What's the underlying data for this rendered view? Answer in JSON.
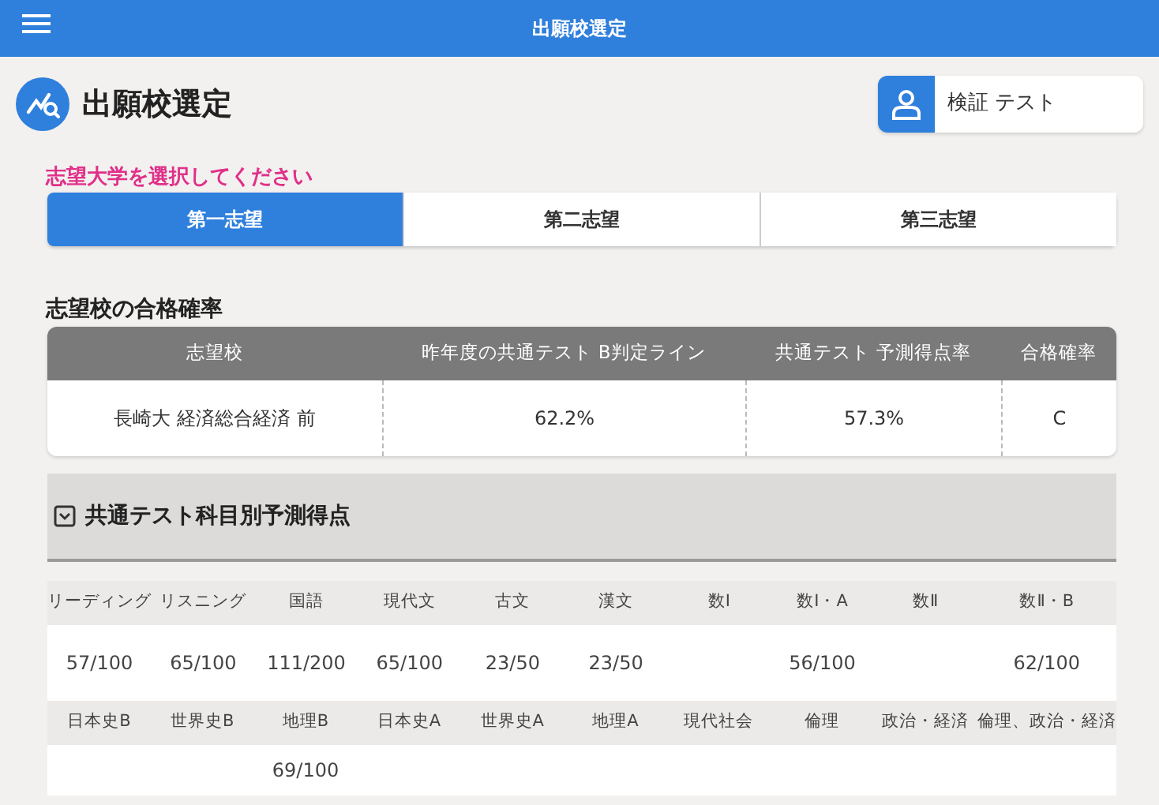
{
  "app_bar": {
    "title": "出願校選定"
  },
  "page": {
    "title": "出願校選定",
    "user": "検証 テスト"
  },
  "prompt": "志望大学を選択してください",
  "tabs": [
    {
      "label": "第一志望",
      "selected": true
    },
    {
      "label": "第二志望",
      "selected": false
    },
    {
      "label": "第三志望",
      "selected": false
    }
  ],
  "probability": {
    "title": "志望校の合格確率",
    "columns": [
      "志望校",
      "昨年度の共通テスト B判定ライン",
      "共通テスト 予測得点率",
      "合格確率"
    ],
    "rows": [
      [
        "長崎大 経済総合経済 前",
        "62.2%",
        "57.3%",
        "C"
      ]
    ]
  },
  "subjects": {
    "title": "共通テスト科目別予測得点",
    "expanded": true,
    "groups": [
      [
        {
          "subject": "リーディング",
          "score": "57/100"
        },
        {
          "subject": "リスニング",
          "score": "65/100"
        },
        {
          "subject": "国語",
          "score": "111/200"
        },
        {
          "subject": "現代文",
          "score": "65/100"
        },
        {
          "subject": "古文",
          "score": "23/50"
        },
        {
          "subject": "漢文",
          "score": "23/50"
        },
        {
          "subject": "数Ⅰ"
        },
        {
          "subject": "数Ⅰ・A",
          "score": "56/100"
        },
        {
          "subject": "数Ⅱ"
        },
        {
          "subject": "数Ⅱ・B",
          "score": "62/100"
        }
      ],
      [
        {
          "subject": "日本史B"
        },
        {
          "subject": "世界史B"
        },
        {
          "subject": "地理B",
          "score": "69/100"
        },
        {
          "subject": "日本史A"
        },
        {
          "subject": "世界史A"
        },
        {
          "subject": "地理A"
        },
        {
          "subject": "現代社会"
        },
        {
          "subject": "倫理"
        },
        {
          "subject": "政治・経済"
        },
        {
          "subject": "倫理、政治・経済"
        }
      ]
    ]
  }
}
